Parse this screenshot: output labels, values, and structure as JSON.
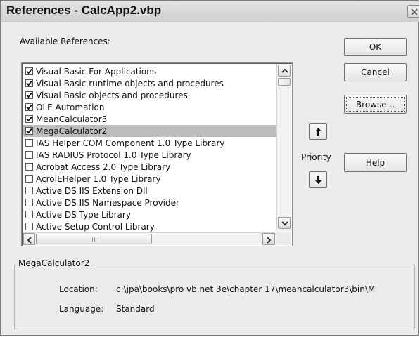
{
  "window": {
    "title": "References - CalcApp2.vbp"
  },
  "available_label": "Available References:",
  "references": [
    {
      "label": "Visual Basic For Applications",
      "checked": true,
      "selected": false
    },
    {
      "label": "Visual Basic runtime objects and procedures",
      "checked": true,
      "selected": false
    },
    {
      "label": "Visual Basic objects and procedures",
      "checked": true,
      "selected": false
    },
    {
      "label": "OLE Automation",
      "checked": true,
      "selected": false
    },
    {
      "label": "MeanCalculator3",
      "checked": true,
      "selected": false
    },
    {
      "label": "MegaCalculator2",
      "checked": true,
      "selected": true
    },
    {
      "label": "IAS Helper COM Component 1.0 Type Library",
      "checked": false,
      "selected": false
    },
    {
      "label": "IAS RADIUS Protocol 1.0 Type Library",
      "checked": false,
      "selected": false
    },
    {
      "label": "Acrobat Access 2.0 Type Library",
      "checked": false,
      "selected": false
    },
    {
      "label": "AcroIEHelper 1.0 Type Library",
      "checked": false,
      "selected": false
    },
    {
      "label": "Active DS IIS Extension Dll",
      "checked": false,
      "selected": false
    },
    {
      "label": "Active DS IIS Namespace Provider",
      "checked": false,
      "selected": false
    },
    {
      "label": "Active DS Type Library",
      "checked": false,
      "selected": false
    },
    {
      "label": "Active Setup Control Library",
      "checked": false,
      "selected": false
    }
  ],
  "buttons": {
    "ok": "OK",
    "cancel": "Cancel",
    "browse": "Browse...",
    "help": "Help"
  },
  "priority_label": "Priority",
  "details": {
    "group_title": "MegaCalculator2",
    "location_label": "Location:",
    "location_value": "c:\\jpa\\books\\pro vb.net 3e\\chapter 17\\meancalculator3\\bin\\M",
    "language_label": "Language:",
    "language_value": "Standard"
  },
  "colors": {
    "dialog_bg": "#ebebeb",
    "selected_row": "#bdbdbd"
  },
  "icons": {
    "close": "close-icon",
    "up": "up-arrow-icon",
    "down": "down-arrow-icon",
    "scroll_up": "scroll-up-icon",
    "scroll_down": "scroll-down-icon",
    "scroll_left": "scroll-left-icon",
    "scroll_right": "scroll-right-icon",
    "check": "checkmark-icon"
  }
}
